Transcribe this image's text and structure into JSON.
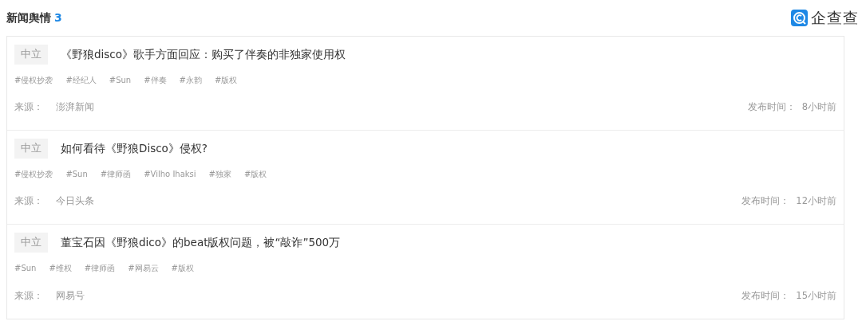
{
  "header": {
    "title": "新闻舆情",
    "count": "3",
    "logo_text": "企查查"
  },
  "news": [
    {
      "sentiment": "中立",
      "title": "《野狼disco》歌手方面回应：购买了伴奏的非独家使用权",
      "tags": [
        "#侵权抄袭",
        "#经纪人",
        "#Sun",
        "#伴奏",
        "#永韵",
        "#版权"
      ],
      "source_label": "来源：",
      "source": "澎湃新闻",
      "time_label": "发布时间：",
      "time": "8小时前"
    },
    {
      "sentiment": "中立",
      "title": "如何看待《野狼Disco》侵权?",
      "tags": [
        "#侵权抄袭",
        "#Sun",
        "#律师函",
        "#Vilho Ihaksi",
        "#独家",
        "#版权"
      ],
      "source_label": "来源：",
      "source": "今日头条",
      "time_label": "发布时间：",
      "time": "12小时前"
    },
    {
      "sentiment": "中立",
      "title": "董宝石因《野狼dico》的beat版权问题，被“敲诈”500万",
      "tags": [
        "#Sun",
        "#维权",
        "#律师函",
        "#网易云",
        "#版权"
      ],
      "source_label": "来源：",
      "source": "网易号",
      "time_label": "发布时间：",
      "time": "15小时前"
    }
  ]
}
